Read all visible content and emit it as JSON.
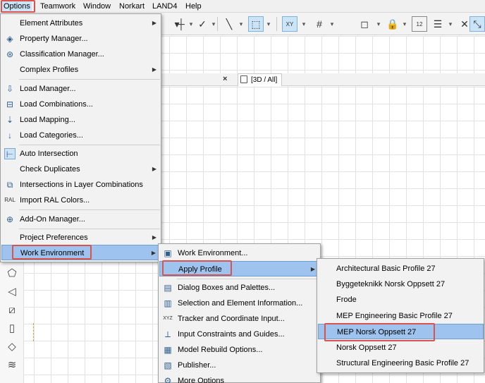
{
  "menubar": {
    "items": [
      "Options",
      "Teamwork",
      "Window",
      "Norkart",
      "LAND4",
      "Help"
    ]
  },
  "tabs": {
    "view_3d": "[3D / All]",
    "close": "×"
  },
  "options_menu": {
    "items": [
      {
        "label": "Element Attributes",
        "icon": "element-attributes-icon",
        "submenu": true
      },
      {
        "label": "Property Manager...",
        "icon": "property-manager-icon",
        "submenu": false
      },
      {
        "label": "Classification Manager...",
        "icon": "classification-manager-icon",
        "submenu": false
      },
      {
        "label": "Complex Profiles",
        "icon": "",
        "submenu": true
      },
      {
        "label": "Load Manager...",
        "icon": "load-manager-icon",
        "submenu": false
      },
      {
        "label": "Load Combinations...",
        "icon": "load-combinations-icon",
        "submenu": false
      },
      {
        "label": "Load Mapping...",
        "icon": "load-mapping-icon",
        "submenu": false
      },
      {
        "label": "Load Categories...",
        "icon": "load-categories-icon",
        "submenu": false
      },
      {
        "label": "Auto Intersection",
        "icon": "auto-intersection-icon",
        "submenu": false
      },
      {
        "label": "Check Duplicates",
        "icon": "",
        "submenu": true
      },
      {
        "label": "Intersections in Layer Combinations",
        "icon": "layer-intersections-icon",
        "submenu": false
      },
      {
        "label": "Import RAL Colors...",
        "icon": "ral-colors-icon",
        "submenu": false
      },
      {
        "label": "Add-On Manager...",
        "icon": "add-on-manager-icon",
        "submenu": false
      },
      {
        "label": "Project Preferences",
        "icon": "",
        "submenu": true
      },
      {
        "label": "Work Environment",
        "icon": "",
        "submenu": true
      }
    ]
  },
  "work_env_menu": {
    "items": [
      {
        "label": "Work Environment...",
        "icon": "work-environment-icon",
        "submenu": false
      },
      {
        "label": "Apply Profile",
        "icon": "",
        "submenu": true
      },
      {
        "label": "Dialog Boxes and Palettes...",
        "icon": "dialog-boxes-icon",
        "submenu": false
      },
      {
        "label": "Selection and Element Information...",
        "icon": "selection-info-icon",
        "submenu": false
      },
      {
        "label": "Tracker and Coordinate Input...",
        "icon": "tracker-icon",
        "submenu": false
      },
      {
        "label": "Input Constraints and Guides...",
        "icon": "input-constraints-icon",
        "submenu": false
      },
      {
        "label": "Model Rebuild Options...",
        "icon": "model-rebuild-icon",
        "submenu": false
      },
      {
        "label": "Publisher...",
        "icon": "publisher-icon",
        "submenu": false
      },
      {
        "label": "More Options",
        "icon": "more-options-icon",
        "submenu": false
      }
    ]
  },
  "profile_menu": {
    "items": [
      "Architectural Basic Profile 27",
      "Byggeteknikk Norsk Oppsett 27",
      "Frode",
      "MEP Engineering Basic Profile 27",
      "MEP Norsk Oppsett 27",
      "Norsk Oppsett 27",
      "Structural Engineering Basic Profile 27"
    ]
  },
  "toolbar_icons": {
    "xy": "XY",
    "twelve": "12"
  },
  "colors": {
    "highlight_border": "#d9534f",
    "hover_fill": "#9ec3ee"
  }
}
